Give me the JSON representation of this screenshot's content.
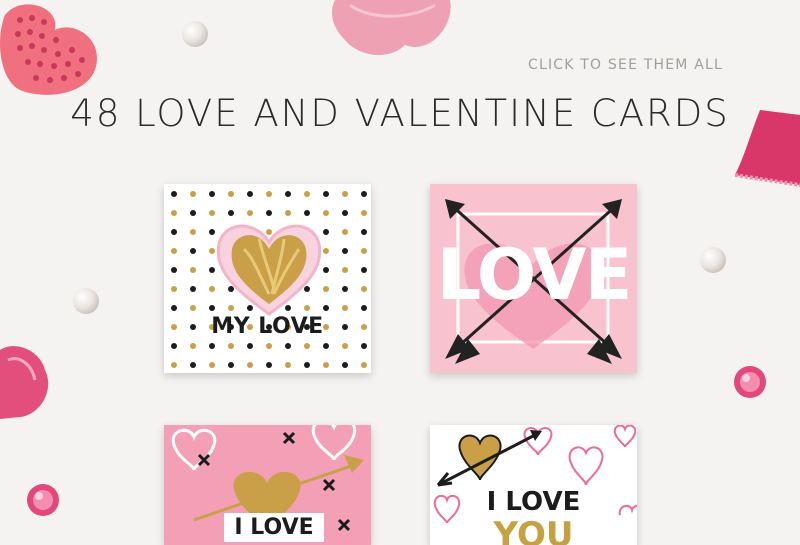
{
  "header": {
    "link_label": "CLICK TO SEE THEM ALL",
    "title": "48 LOVE AND VALENTINE CARDS"
  },
  "cards": [
    {
      "text": "MY LOVE"
    },
    {
      "text": "LOVE"
    },
    {
      "text": "I LOVE"
    },
    {
      "text_line1": "I LOVE",
      "text_line2": "YOU"
    }
  ],
  "colors": {
    "background": "#f5f3f1",
    "pink": "#f8c2cf",
    "hot_pink": "#e0457a",
    "gold": "#c7a042"
  }
}
